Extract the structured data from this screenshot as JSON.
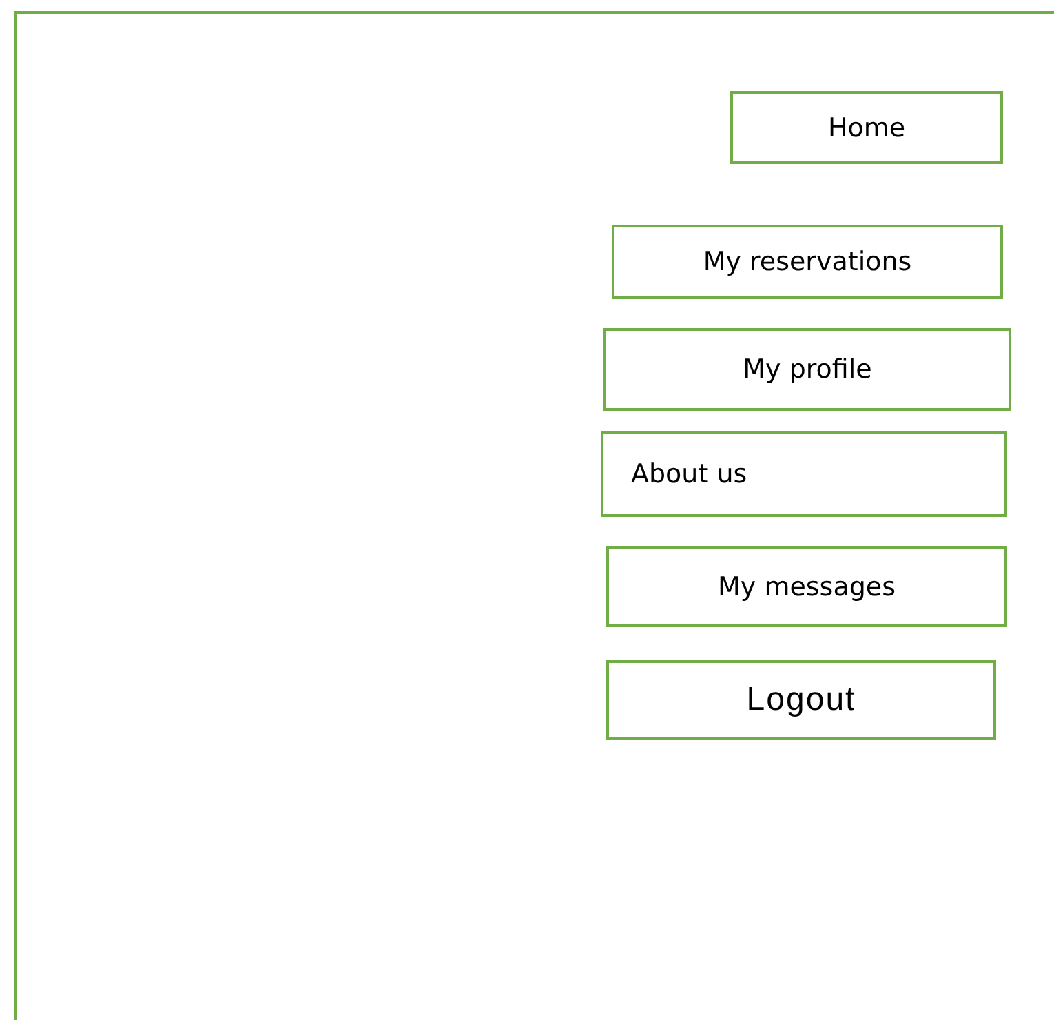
{
  "menu": [
    {
      "label": "Home",
      "kind": "center"
    },
    {
      "label": "My reservations",
      "kind": "center"
    },
    {
      "label": "My profile",
      "kind": "center"
    },
    {
      "label": "About us",
      "kind": "left"
    },
    {
      "label": "My messages",
      "kind": "center"
    },
    {
      "label": "Logout",
      "kind": "large"
    }
  ]
}
